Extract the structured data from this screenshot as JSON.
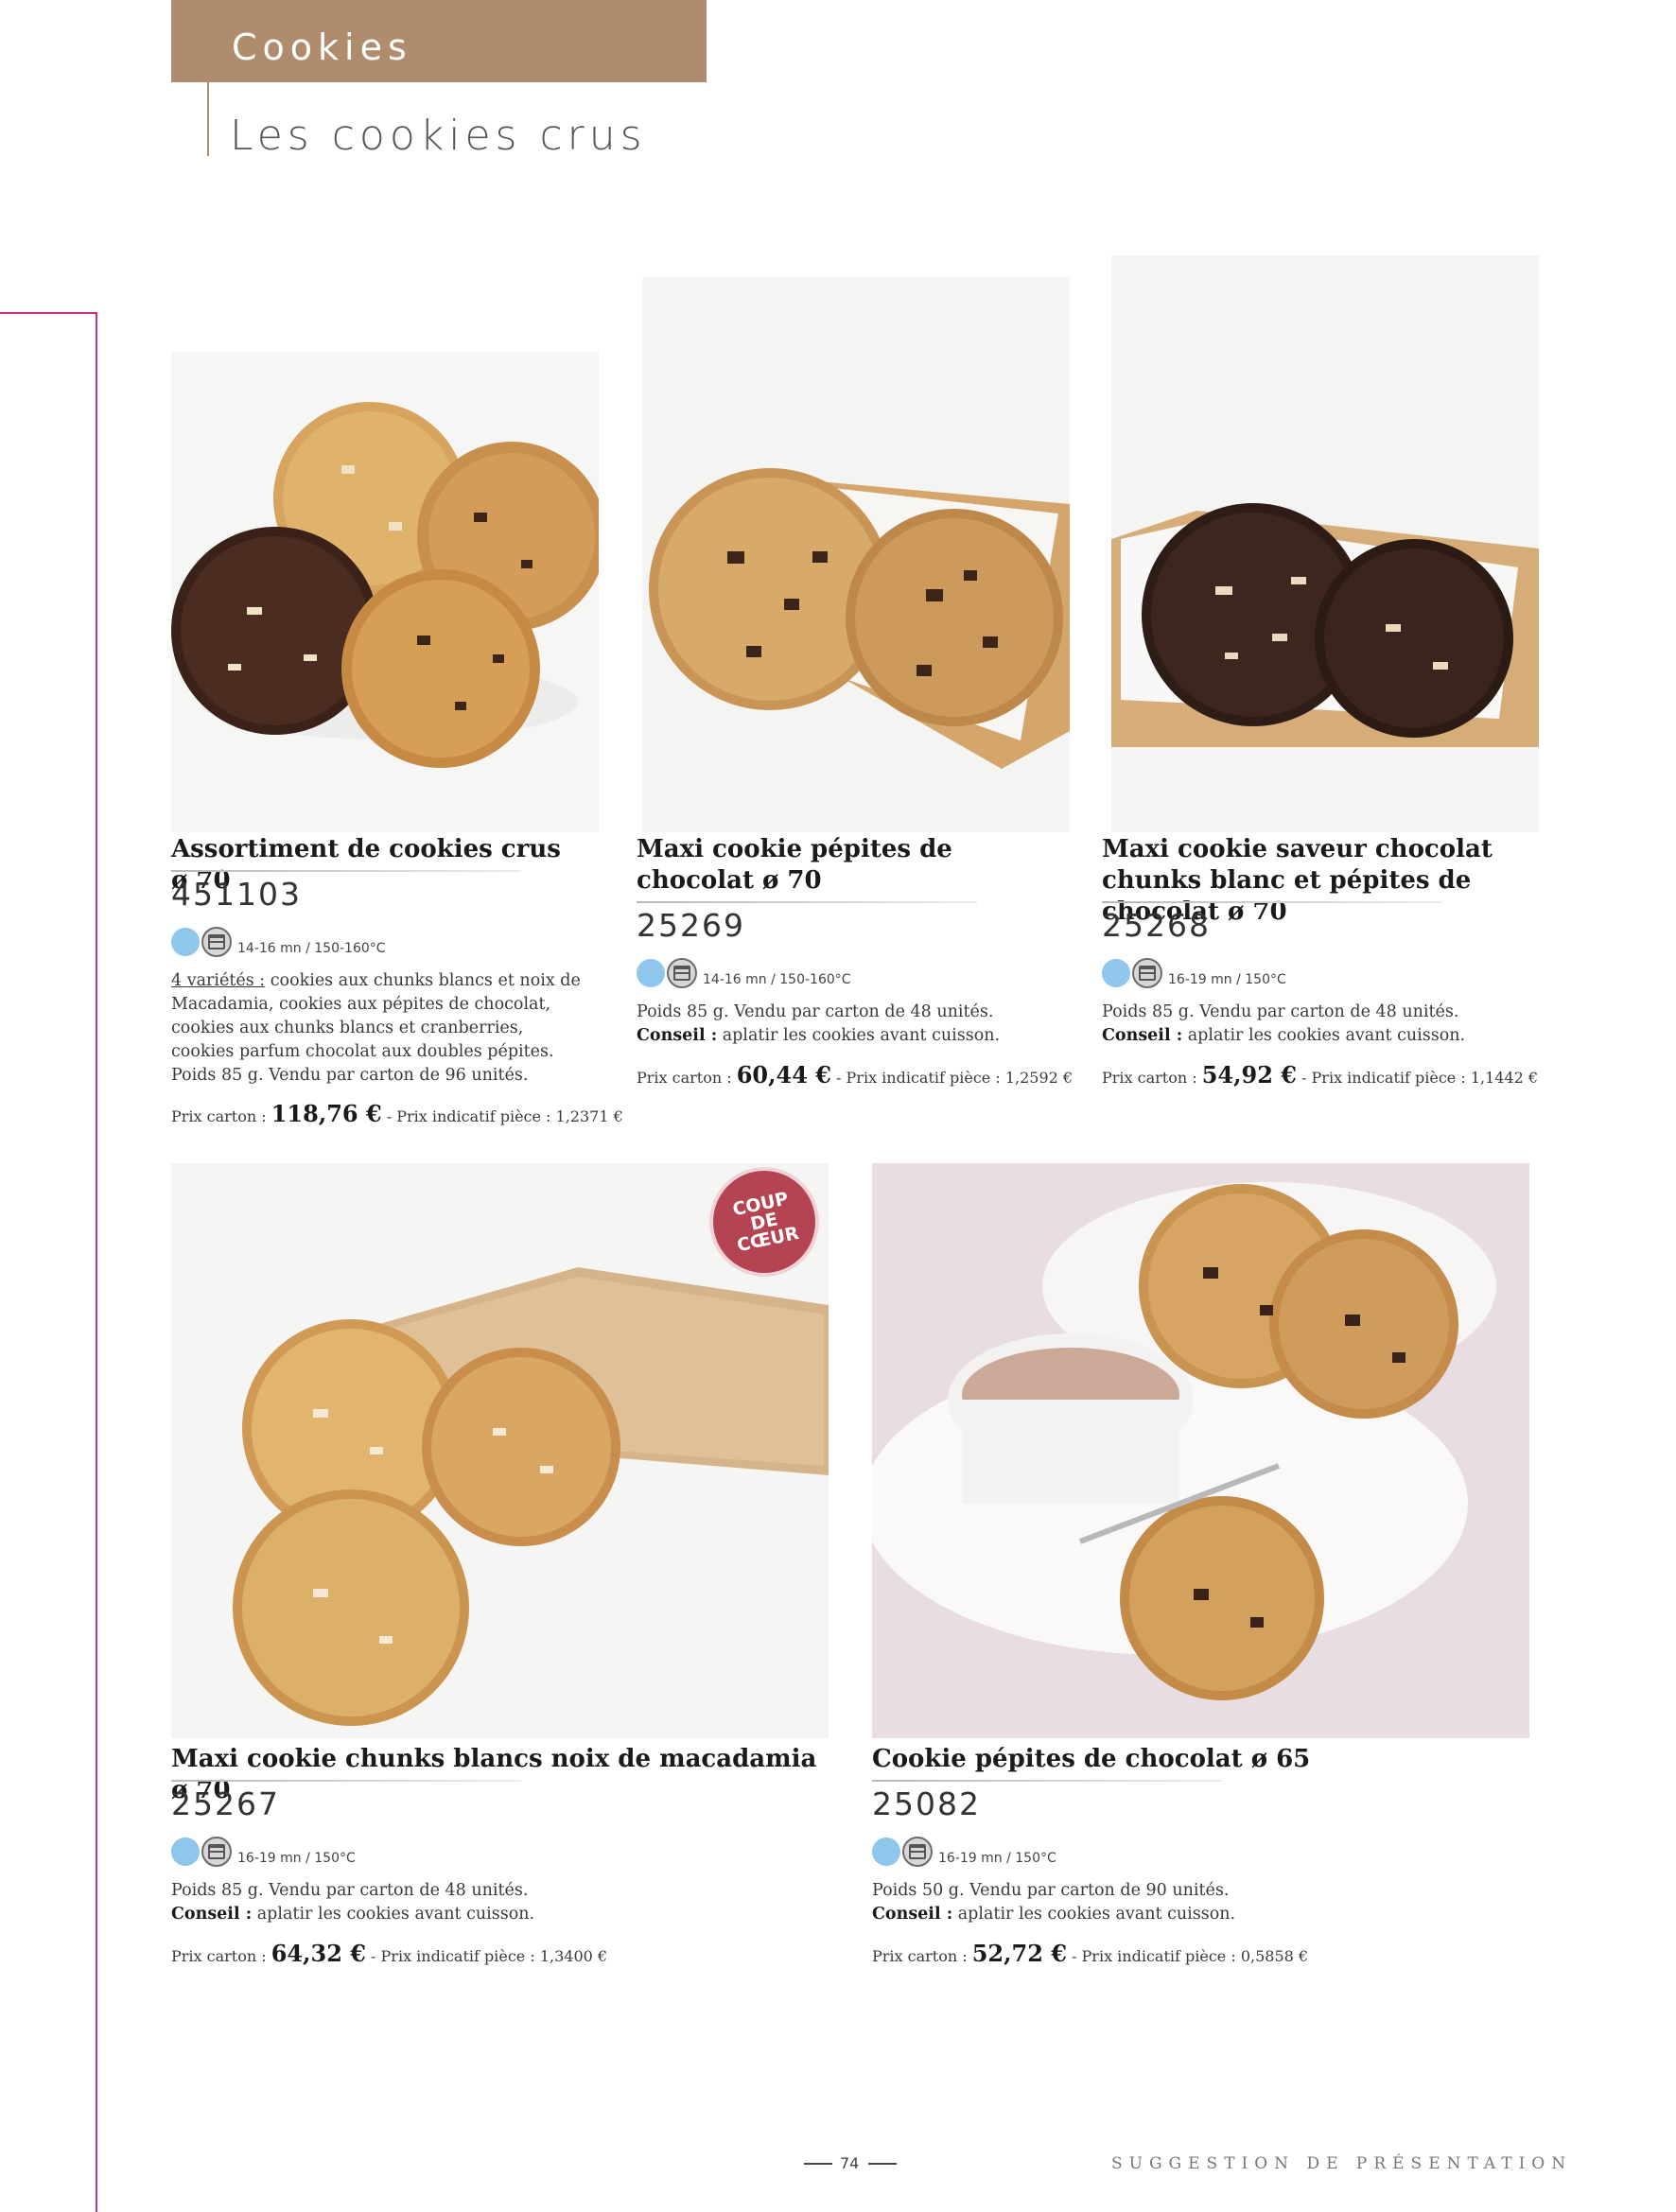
{
  "header": {
    "section": "Cookies",
    "subtitle": "Les cookies crus"
  },
  "products": [
    {
      "name": "Assortiment de cookies crus ø 70",
      "code": "451103",
      "bake": "14-16 mn / 150-160°C",
      "desc_lead": "4 variétés :",
      "desc_text": "cookies aux chunks blancs et noix de Macadamia, cookies aux pépites de chocolat, cookies aux chunks blancs et cranberries, cookies parfum chocolat aux doubles pépites.",
      "desc_text2": "Poids 85 g. Vendu par carton de 96 unités.",
      "price_label": "Prix carton :",
      "price": "118,76 €",
      "unit_price": "- Prix indicatif pièce : 1,2371 €"
    },
    {
      "name": "Maxi cookie pépites de chocolat ø 70",
      "code": "25269",
      "bake": "14-16 mn / 150-160°C",
      "weight": "Poids 85 g. Vendu par carton de 48 unités.",
      "tip_label": "Conseil :",
      "tip": "aplatir les cookies avant cuisson.",
      "price_label": "Prix carton :",
      "price": "60,44 €",
      "unit_price": "- Prix indicatif pièce : 1,2592 €"
    },
    {
      "name": "Maxi cookie saveur chocolat chunks blanc et pépites de chocolat ø 70",
      "code": "25268",
      "bake": "16-19 mn / 150°C",
      "weight": "Poids 85 g. Vendu par carton de 48 unités.",
      "tip_label": "Conseil :",
      "tip": "aplatir les cookies avant cuisson.",
      "price_label": "Prix carton :",
      "price": "54,92 €",
      "unit_price": "- Prix indicatif pièce : 1,1442 €"
    },
    {
      "name": "Maxi cookie chunks blancs noix de macadamia ø 70",
      "code": "25267",
      "bake": "16-19 mn / 150°C",
      "weight": "Poids 85 g. Vendu par carton de 48 unités.",
      "tip_label": "Conseil :",
      "tip": "aplatir les cookies avant cuisson.",
      "price_label": "Prix carton :",
      "price": "64,32 €",
      "unit_price": "- Prix indicatif pièce : 1,3400 €"
    },
    {
      "name": "Cookie pépites de chocolat ø 65",
      "code": "25082",
      "bake": "16-19 mn / 150°C",
      "weight": "Poids 50 g. Vendu par carton de 90 unités.",
      "tip_label": "Conseil :",
      "tip": "aplatir les cookies avant cuisson.",
      "price_label": "Prix carton :",
      "price": "52,72 €",
      "unit_price": "- Prix indicatif pièce : 0,5858 €"
    }
  ],
  "badge": {
    "line1": "COUP",
    "line2": "DE",
    "line3": "CŒUR"
  },
  "footer": {
    "page": "74",
    "note": "SUGGESTION DE PRÉSENTATION"
  },
  "colors": {
    "brand": "#b08c6e",
    "margin_line": "#c2308a",
    "badge": "#b54452",
    "dot": "#8ec6ec"
  },
  "icons": [
    "product-type-dot-icon",
    "oven-icon"
  ]
}
